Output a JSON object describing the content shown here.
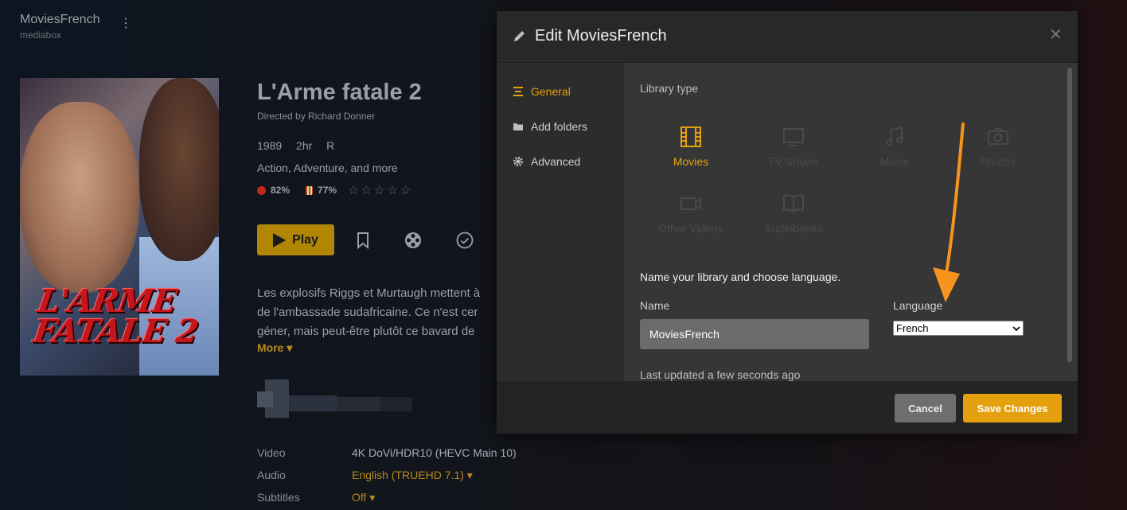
{
  "library": {
    "name": "MoviesFrench",
    "server": "mediabox"
  },
  "movie": {
    "title": "L'Arme fatale 2",
    "director": "Directed by Richard Donner",
    "year": "1989",
    "duration": "2hr",
    "rating": "R",
    "genres": "Action, Adventure, and more",
    "critic_score": "82%",
    "audience_score": "77%",
    "poster_text": "L'ARME FATALE 2",
    "play_label": "Play",
    "summary_lines": [
      "Les explosifs Riggs et Murtaugh mettent à",
      "de l'ambassade sudafricaine. Ce n'est cer",
      "géner, mais peut-être plutôt ce bavard de"
    ],
    "more_label": "More ▾",
    "meta": {
      "video_label": "Video",
      "video_value": "4K DoVi/HDR10 (HEVC Main 10)",
      "audio_label": "Audio",
      "audio_value": "English (TRUEHD 7.1) ▾",
      "subtitles_label": "Subtitles",
      "subtitles_value": "Off ▾"
    }
  },
  "modal": {
    "title": "Edit MoviesFrench",
    "nav": [
      {
        "label": "General",
        "icon": "list-icon",
        "active": true
      },
      {
        "label": "Add folders",
        "icon": "folder-icon",
        "active": false
      },
      {
        "label": "Advanced",
        "icon": "gear-icon",
        "active": false
      }
    ],
    "library_type_label": "Library type",
    "types": [
      {
        "label": "Movies",
        "icon": "film-icon",
        "active": true
      },
      {
        "label": "TV Shows",
        "icon": "tv-icon",
        "active": false
      },
      {
        "label": "Music",
        "icon": "music-icon",
        "active": false
      },
      {
        "label": "Photos",
        "icon": "camera-icon",
        "active": false
      },
      {
        "label": "Other Videos",
        "icon": "video-camera-icon",
        "active": false
      },
      {
        "label": "Audiobooks",
        "icon": "book-icon",
        "active": false
      }
    ],
    "instructions": "Name your library and choose language.",
    "name_label": "Name",
    "name_value": "MoviesFrench",
    "language_label": "Language",
    "language_value": "French",
    "last_updated": "Last updated a few seconds ago",
    "cancel_label": "Cancel",
    "save_label": "Save Changes"
  },
  "colors": {
    "accent": "#e5a00d",
    "arrow": "#f7941d",
    "background": "#0f1216"
  }
}
